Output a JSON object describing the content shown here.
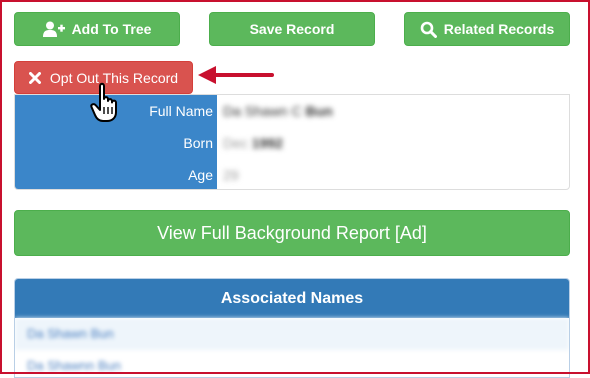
{
  "buttons": {
    "add_to_tree": "Add To Tree",
    "save_record": "Save Record",
    "related_records": "Related Records",
    "opt_out": "Opt Out This Record",
    "view_full_report": "View Full Background Report [Ad]"
  },
  "record": {
    "rows": [
      {
        "label": "Full Name",
        "value_plain": "Da Shawn C ",
        "value_bold": "Bun"
      },
      {
        "label": "Born",
        "value_plain": "Dec ",
        "value_bold": "1992"
      },
      {
        "label": "Age",
        "value_plain": "29",
        "value_bold": ""
      }
    ]
  },
  "associated": {
    "title": "Associated Names",
    "items": [
      "Da Shawn Bun",
      "Da Shawnn Bun"
    ]
  },
  "colors": {
    "green": "#5cb85c",
    "red": "#d9534f",
    "blue_label": "#3b86c9",
    "panel_header": "#337ab7",
    "frame": "#c8102e"
  },
  "icons": {
    "add_to_tree": "user-plus-icon",
    "related_records": "search-icon",
    "opt_out": "close-icon",
    "pointer": "hand-pointer-icon",
    "annotation": "arrow-left-icon"
  }
}
